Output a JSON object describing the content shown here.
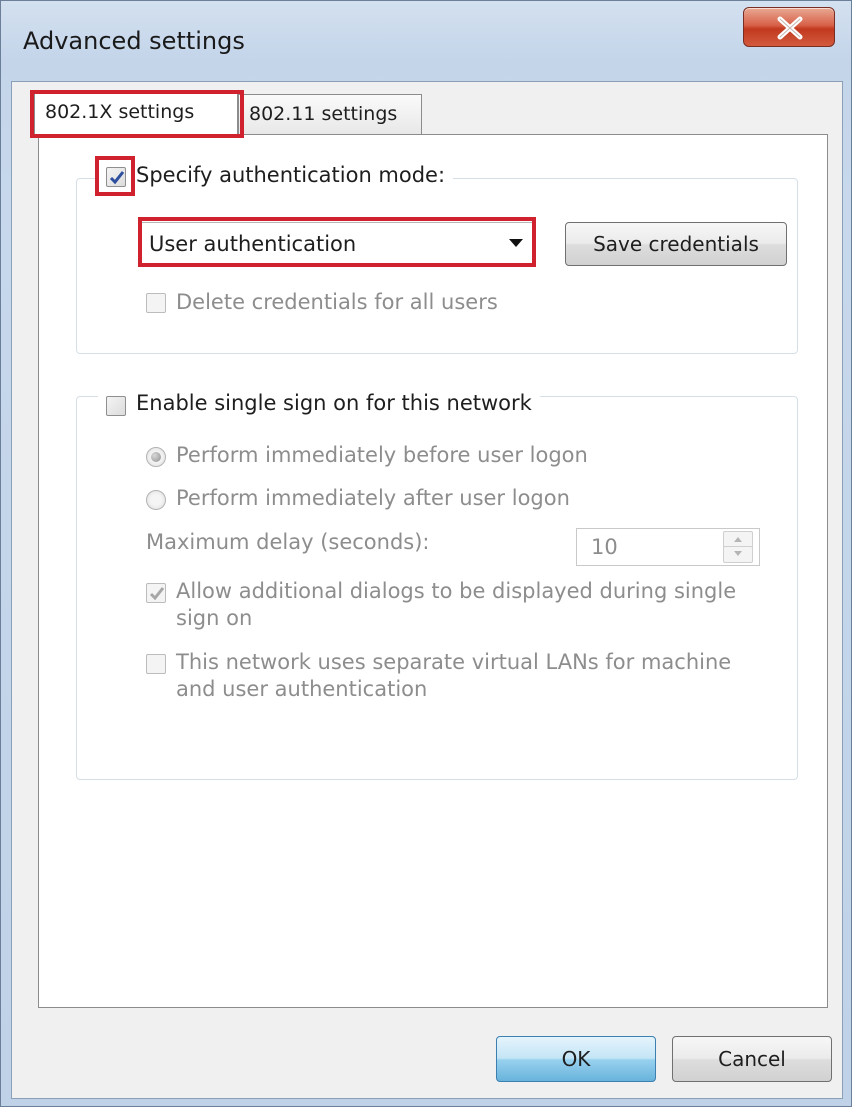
{
  "window": {
    "title": "Advanced settings"
  },
  "tabs": [
    "802.1X settings",
    "802.11 settings"
  ],
  "auth_group": {
    "specify_mode_label": "Specify authentication mode:",
    "specify_mode_checked": true,
    "mode_selected": "User authentication",
    "save_credentials_label": "Save credentials",
    "delete_credentials_label": "Delete credentials for all users",
    "delete_credentials_checked": false
  },
  "sso_group": {
    "enable_label": "Enable single sign on for this network",
    "enable_checked": false,
    "radio_before_label": "Perform immediately before user logon",
    "radio_after_label": "Perform immediately after user logon",
    "selected_option": "Perform immediately before user logon",
    "max_delay_label": "Maximum delay (seconds):",
    "max_delay_value": "10",
    "allow_dialogs_label_line1": "Allow additional dialogs to be displayed during single",
    "allow_dialogs_label_line2": "sign on",
    "allow_dialogs_checked": true,
    "separate_vlans_label_line1": "This network uses separate virtual LANs for machine",
    "separate_vlans_label_line2": "and user authentication",
    "separate_vlans_checked": false
  },
  "footer": {
    "ok_label": "OK",
    "cancel_label": "Cancel"
  },
  "colors": {
    "highlight": "#d0212e",
    "checkmark": "#2d4f9e"
  }
}
